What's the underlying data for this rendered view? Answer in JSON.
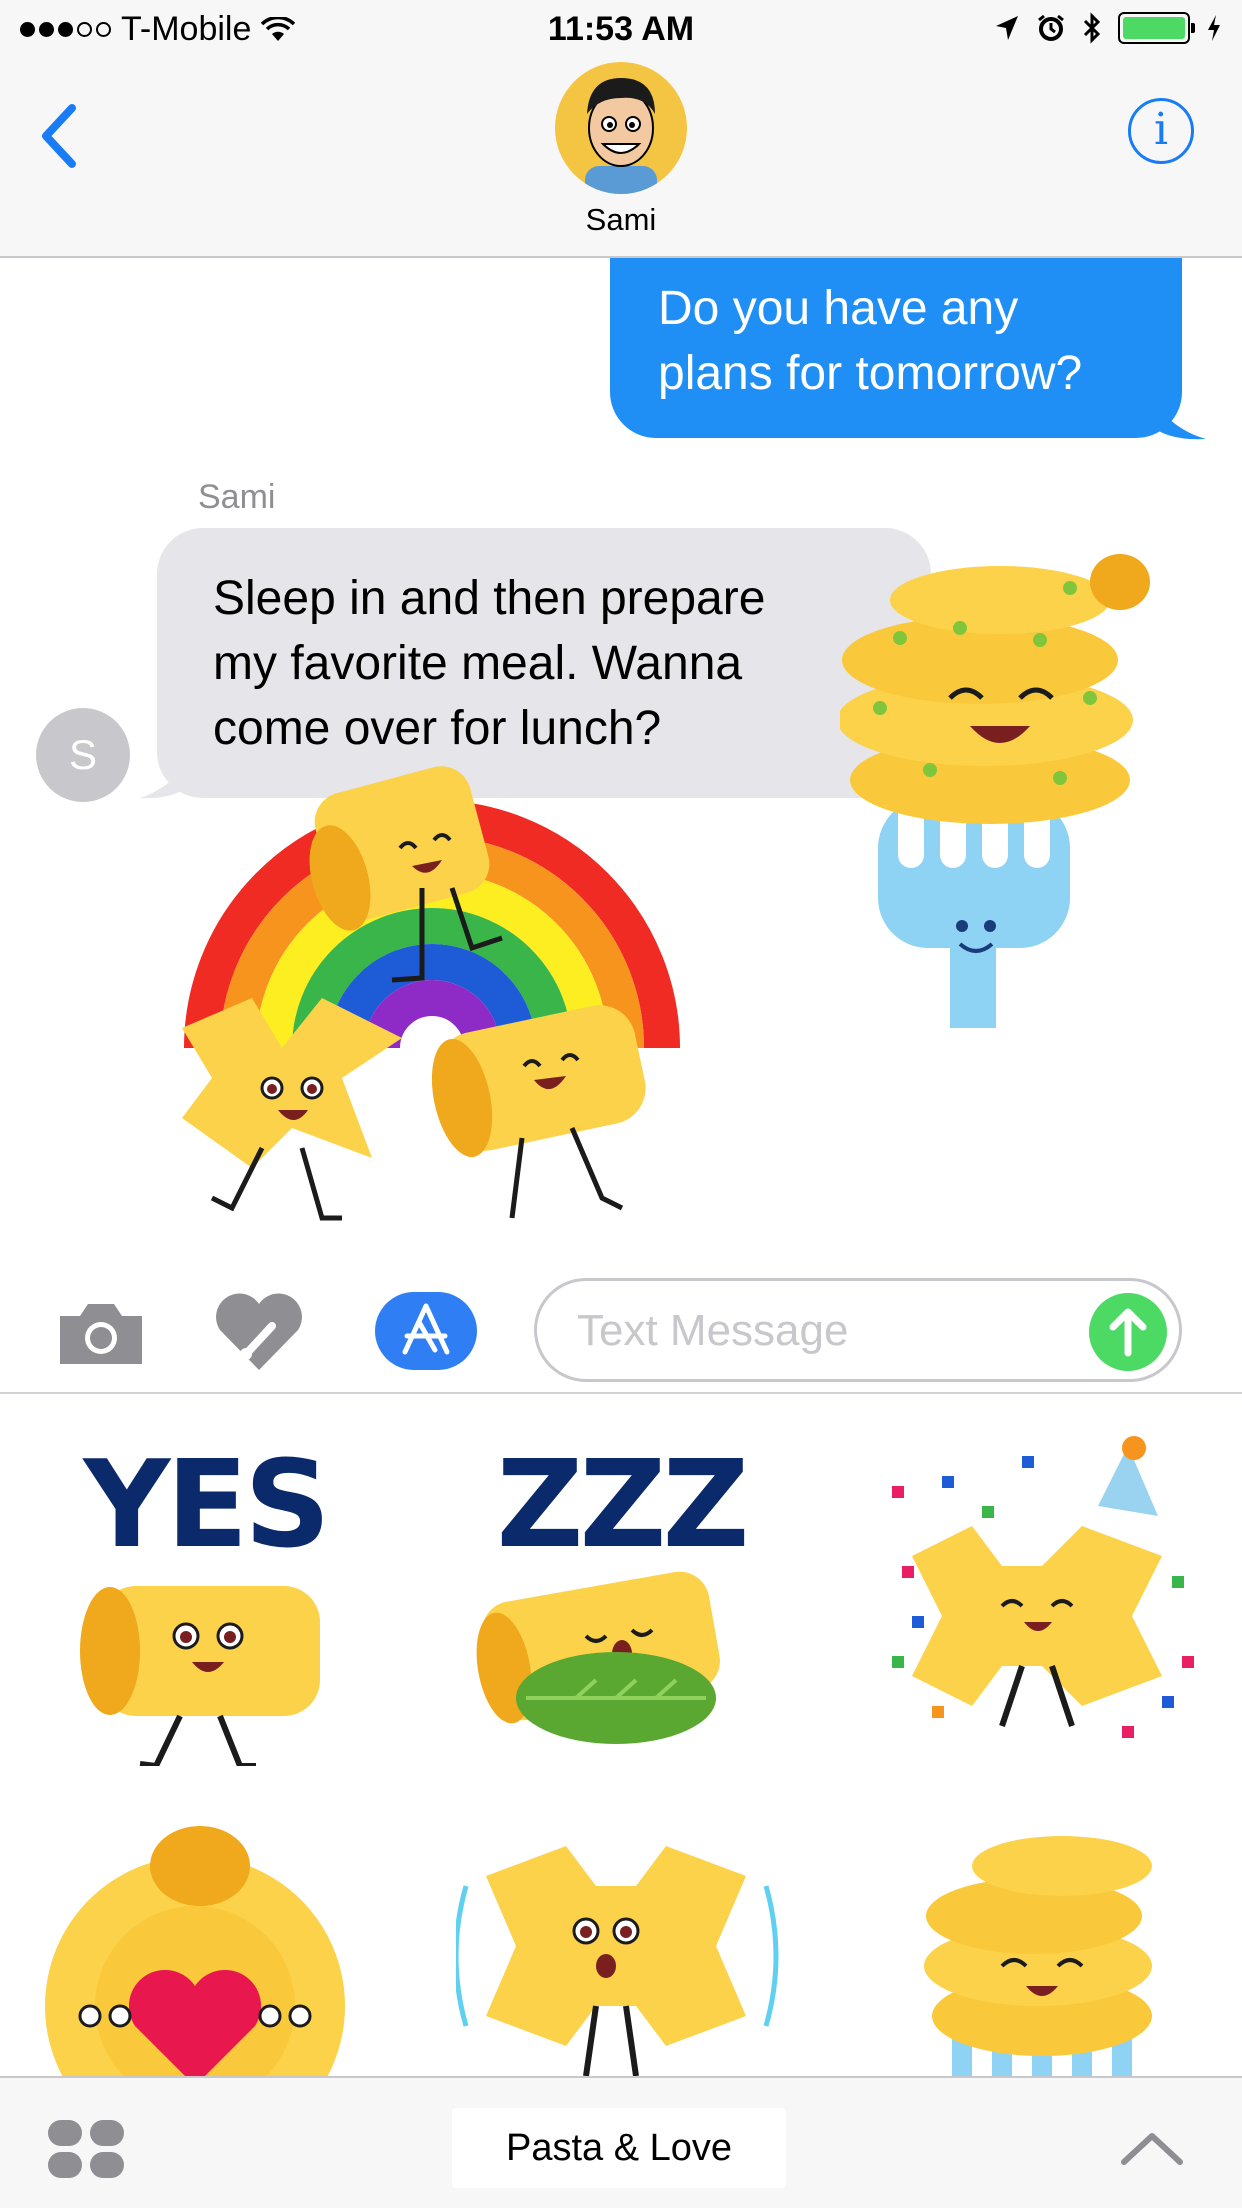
{
  "status_bar": {
    "carrier": "T-Mobile",
    "time": "11:53 AM",
    "signal_bars_filled": 3,
    "signal_bars_total": 5,
    "battery_level": 1.0,
    "battery_color": "#4cd964",
    "icons": [
      "wifi-icon",
      "location-arrow-icon",
      "alarm-icon",
      "bluetooth-icon",
      "battery-icon",
      "charging-bolt-icon"
    ]
  },
  "header": {
    "contact_name": "Sami",
    "back_icon": "chevron-left-icon",
    "info_label": "i",
    "accent_color": "#1a7cf5"
  },
  "conversation": {
    "sent_message": {
      "line1": "Do you have any",
      "line2": "plans for tomorrow?"
    },
    "received_message": {
      "sender": "Sami",
      "avatar_initial": "S",
      "line1": "Sleep in and then prepare",
      "line2": "my favorite meal. Wanna",
      "line3": "come over for lunch?"
    },
    "stickers": [
      "pasta-fork-sticker",
      "pasta-rainbow-sticker"
    ],
    "colors": {
      "sent_bubble": "#1f8ff6",
      "received_bubble": "#e5e5ea"
    }
  },
  "input": {
    "placeholder": "Text Message",
    "value": "",
    "send_color": "#4cd964",
    "icons": [
      "camera-icon",
      "digital-touch-heart-icon",
      "app-store-icon",
      "send-arrow-icon"
    ]
  },
  "sticker_drawer": {
    "pack_name": "Pasta & Love",
    "stickers": [
      {
        "name": "yes-sticker",
        "word": "YES"
      },
      {
        "name": "zzz-sticker",
        "word": "ZZZ"
      },
      {
        "name": "party-bowtie-sticker",
        "word": ""
      },
      {
        "name": "love-ring-sticker",
        "word": ""
      },
      {
        "name": "shaking-bowtie-sticker",
        "word": ""
      },
      {
        "name": "pasta-fork-small-sticker",
        "word": ""
      }
    ]
  },
  "bottom_bar": {
    "pack_label": "Pasta & Love",
    "icons": [
      "app-drawer-grid-icon",
      "chevron-up-icon"
    ]
  }
}
